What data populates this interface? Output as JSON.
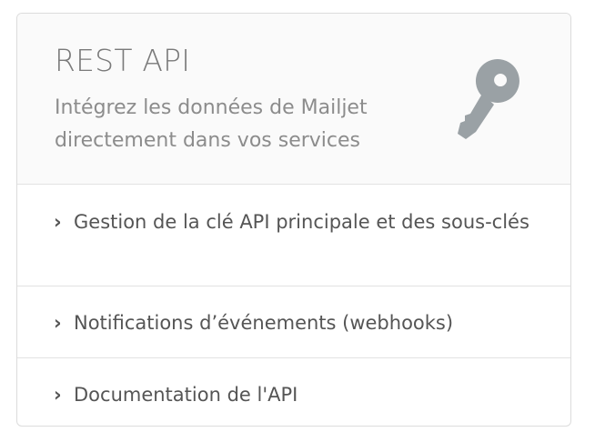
{
  "card": {
    "title": "REST API",
    "subtitle": "Intégrez les données de Mailjet directement dans vos services",
    "icon": "key-icon",
    "icon_color": "#9aa1a5"
  },
  "links": [
    {
      "chevron": "›",
      "label": "Gestion de la clé API principale et des sous-clés"
    },
    {
      "chevron": "›",
      "label": "Notifications d’événements (webhooks)"
    },
    {
      "chevron": "›",
      "label": "Documentation de l'API"
    }
  ]
}
